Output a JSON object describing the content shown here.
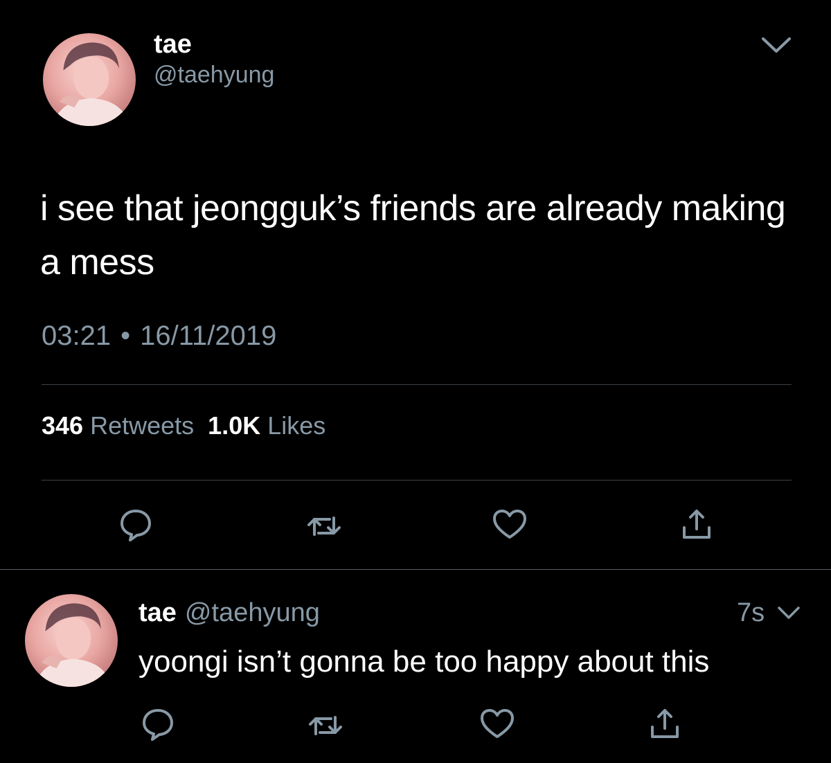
{
  "main_tweet": {
    "author_name": "tae",
    "author_handle": "@taehyung",
    "text": "i see that jeongguk’s friends are already making a mess",
    "time": "03:21",
    "separator": "•",
    "date": "16/11/2019",
    "retweet_count": "346",
    "retweet_label": "Retweets",
    "like_count": "1.0K",
    "like_label": "Likes",
    "actions": [
      "reply-icon",
      "retweet-icon",
      "like-icon",
      "share-icon"
    ]
  },
  "reply_tweet": {
    "author_name": "tae",
    "author_handle": "@taehyung",
    "time": "7s",
    "text": "yoongi isn’t gonna be too happy about this",
    "actions": [
      "reply-icon",
      "retweet-icon",
      "like-icon",
      "share-icon"
    ]
  },
  "colors": {
    "background": "#000000",
    "text_primary": "#ffffff",
    "text_secondary": "#8899a6",
    "divider": "#3d4349"
  }
}
